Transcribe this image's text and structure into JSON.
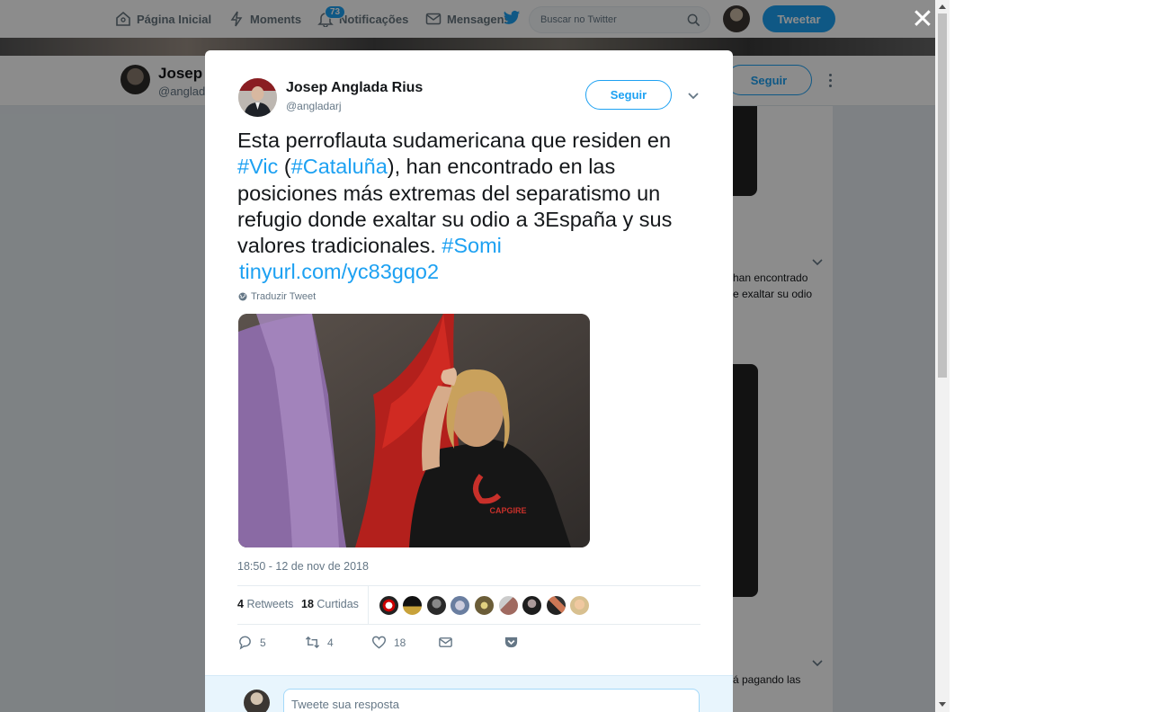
{
  "nav": {
    "home": "Página Inicial",
    "moments": "Moments",
    "notifications": "Notificações",
    "notifications_badge": "73",
    "messages": "Mensagens",
    "search_placeholder": "Buscar no Twitter",
    "tweet_button": "Tweetar"
  },
  "profile_bar": {
    "name": "Josep A",
    "handle": "@anglad",
    "follow_label": "Seguir"
  },
  "timeline_snippets": {
    "text1_line1": "han encontrado",
    "text1_line2": "e exaltar su odio",
    "text2_line1": "á pagando las"
  },
  "tweet": {
    "author_name": "Josep Anglada Rius",
    "author_handle": "@angladarj",
    "follow_label": "Seguir",
    "text_part1": "Esta perroflauta sudamericana que residen en ",
    "hashtag_vic": "#Vic",
    "text_part2": " (",
    "hashtag_cataluna": "#Cataluña",
    "text_part3": "), han encontrado en las posiciones más extremas del separatismo un refugio donde exaltar su odio a 3España y sus valores tradicionales. ",
    "hashtag_somi": "#Somi",
    "link": "tinyurl.com/yc83gqo2",
    "translate_label": "Traduzir Tweet",
    "shirt_text": "CAPGIRE",
    "timestamp": "18:50 - 12 de nov de 2018",
    "retweets_count": "4",
    "retweets_label": "Retweets",
    "likes_count": "18",
    "likes_label": "Curtidas",
    "reply_count": "5",
    "retweet_action_count": "4",
    "like_action_count": "18"
  },
  "reply": {
    "placeholder": "Tweete sua resposta"
  },
  "colors": {
    "accent": "#1da1f2",
    "text": "#14171a",
    "muted": "#657786"
  }
}
